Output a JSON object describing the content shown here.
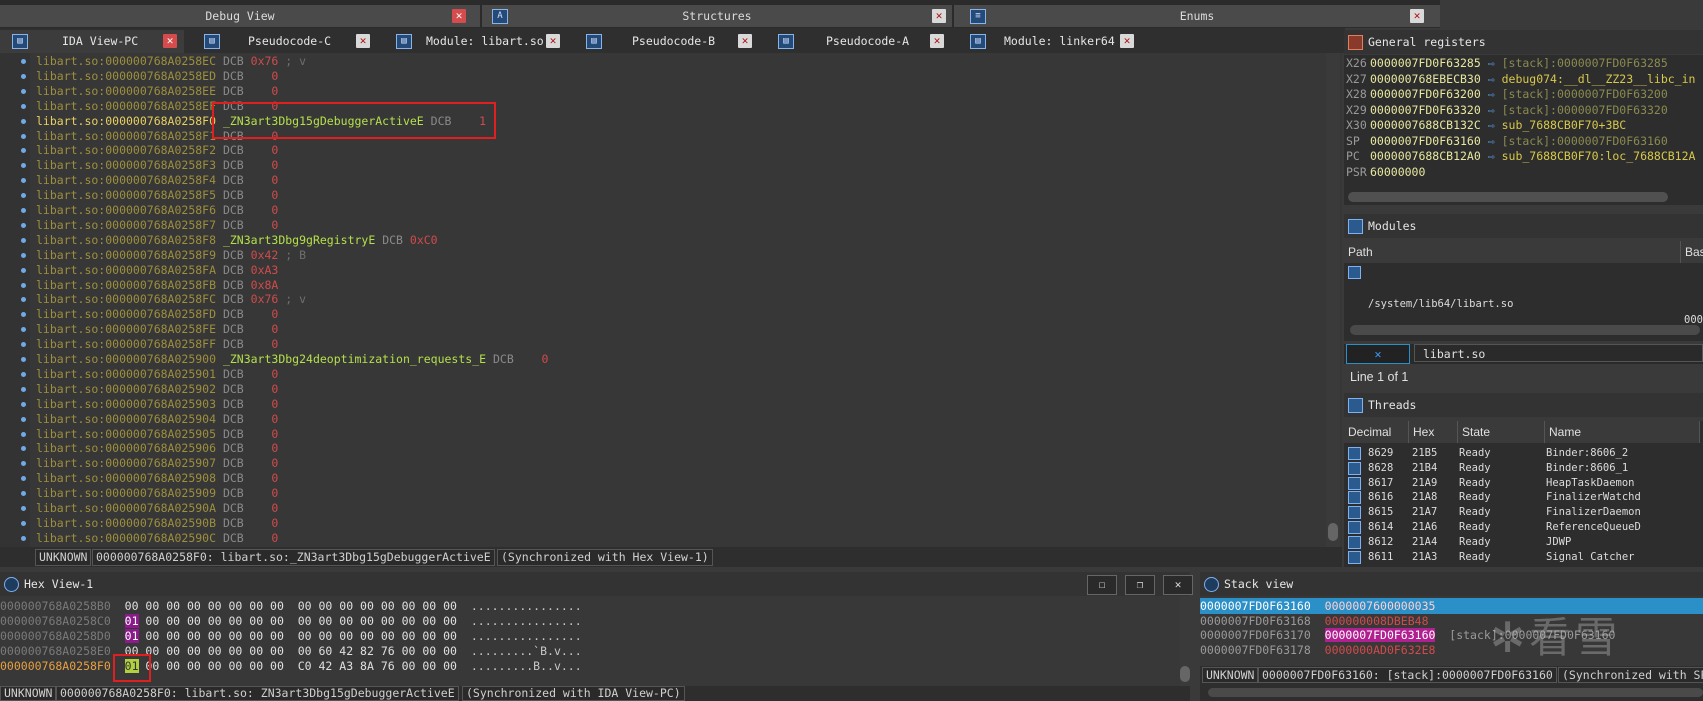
{
  "top_tabs": [
    {
      "label": "Debug View"
    },
    {
      "label": "Structures"
    },
    {
      "label": "Enums"
    }
  ],
  "sub_tabs": [
    {
      "label": "IDA View-PC"
    },
    {
      "label": "Pseudocode-C"
    },
    {
      "label": "Module: libart.so"
    },
    {
      "label": "Pseudocode-B"
    },
    {
      "label": "Pseudocode-A"
    },
    {
      "label": "Module: linker64"
    }
  ],
  "disasm": {
    "lines": [
      {
        "addr": "libart.so:000000768A0258EC",
        "tail": " DCB ",
        "val": "0x76",
        "cmt": " ; v"
      },
      {
        "addr": "libart.so:000000768A0258ED",
        "tail": " DCB ",
        "val": "   0",
        "cmt": ""
      },
      {
        "addr": "libart.so:000000768A0258EE",
        "tail": " DCB ",
        "val": "   0",
        "cmt": ""
      },
      {
        "addr": "libart.so:000000768A0258EF",
        "tail": " DCB ",
        "val": "   0",
        "cmt": ""
      },
      {
        "addr": "libart.so:000000768A0258F0",
        "sym": " _ZN3art3Dbg15gDebuggerActiveE",
        "tail": " DCB ",
        "val": "   1",
        "cur": true
      },
      {
        "addr": "libart.so:000000768A0258F1",
        "tail": " DCB ",
        "val": "   0",
        "cmt": ""
      },
      {
        "addr": "libart.so:000000768A0258F2",
        "tail": " DCB ",
        "val": "   0",
        "cmt": ""
      },
      {
        "addr": "libart.so:000000768A0258F3",
        "tail": " DCB ",
        "val": "   0",
        "cmt": ""
      },
      {
        "addr": "libart.so:000000768A0258F4",
        "tail": " DCB ",
        "val": "   0",
        "cmt": ""
      },
      {
        "addr": "libart.so:000000768A0258F5",
        "tail": " DCB ",
        "val": "   0",
        "cmt": ""
      },
      {
        "addr": "libart.so:000000768A0258F6",
        "tail": " DCB ",
        "val": "   0",
        "cmt": ""
      },
      {
        "addr": "libart.so:000000768A0258F7",
        "tail": " DCB ",
        "val": "   0",
        "cmt": ""
      },
      {
        "addr": "libart.so:000000768A0258F8",
        "sym": " _ZN3art3Dbg9gRegistryE",
        "tail": " DCB ",
        "val": "0xC0",
        "cmt": ""
      },
      {
        "addr": "libart.so:000000768A0258F9",
        "tail": " DCB ",
        "val": "0x42",
        "cmt": " ; B"
      },
      {
        "addr": "libart.so:000000768A0258FA",
        "tail": " DCB ",
        "val": "0xA3",
        "cmt": ""
      },
      {
        "addr": "libart.so:000000768A0258FB",
        "tail": " DCB ",
        "val": "0x8A",
        "cmt": ""
      },
      {
        "addr": "libart.so:000000768A0258FC",
        "tail": " DCB ",
        "val": "0x76",
        "cmt": " ; v"
      },
      {
        "addr": "libart.so:000000768A0258FD",
        "tail": " DCB ",
        "val": "   0",
        "cmt": ""
      },
      {
        "addr": "libart.so:000000768A0258FE",
        "tail": " DCB ",
        "val": "   0",
        "cmt": ""
      },
      {
        "addr": "libart.so:000000768A0258FF",
        "tail": " DCB ",
        "val": "   0",
        "cmt": ""
      },
      {
        "addr": "libart.so:000000768A025900",
        "sym": " _ZN3art3Dbg24deoptimization_requests_E",
        "tail": " DCB ",
        "val": "   0",
        "cmt": ""
      },
      {
        "addr": "libart.so:000000768A025901",
        "tail": " DCB ",
        "val": "   0",
        "cmt": ""
      },
      {
        "addr": "libart.so:000000768A025902",
        "tail": " DCB ",
        "val": "   0",
        "cmt": ""
      },
      {
        "addr": "libart.so:000000768A025903",
        "tail": " DCB ",
        "val": "   0",
        "cmt": ""
      },
      {
        "addr": "libart.so:000000768A025904",
        "tail": " DCB ",
        "val": "   0",
        "cmt": ""
      },
      {
        "addr": "libart.so:000000768A025905",
        "tail": " DCB ",
        "val": "   0",
        "cmt": ""
      },
      {
        "addr": "libart.so:000000768A025906",
        "tail": " DCB ",
        "val": "   0",
        "cmt": ""
      },
      {
        "addr": "libart.so:000000768A025907",
        "tail": " DCB ",
        "val": "   0",
        "cmt": ""
      },
      {
        "addr": "libart.so:000000768A025908",
        "tail": " DCB ",
        "val": "   0",
        "cmt": ""
      },
      {
        "addr": "libart.so:000000768A025909",
        "tail": " DCB ",
        "val": "   0",
        "cmt": ""
      },
      {
        "addr": "libart.so:000000768A02590A",
        "tail": " DCB ",
        "val": "   0",
        "cmt": ""
      },
      {
        "addr": "libart.so:000000768A02590B",
        "tail": " DCB ",
        "val": "   0",
        "cmt": ""
      },
      {
        "addr": "libart.so:000000768A02590C",
        "tail": " DCB ",
        "val": "   0",
        "cmt": ""
      }
    ]
  },
  "status1": {
    "mode": "UNKNOWN",
    "location": "000000768A0258F0: libart.so:_ZN3art3Dbg15gDebuggerActiveE",
    "sync": "(Synchronized with Hex View-1)"
  },
  "registers": {
    "title": "General registers",
    "rows": [
      {
        "name": "X26",
        "value": "0000007FD0F63285",
        "desc": "[stack]:0000007FD0F63285",
        "gray": true
      },
      {
        "name": "X27",
        "value": "000000768EBECB30",
        "desc": "debug074:__dl__ZZ23__libc_in",
        "gray": false
      },
      {
        "name": "X28",
        "value": "0000007FD0F63200",
        "desc": "[stack]:0000007FD0F63200",
        "gray": true
      },
      {
        "name": "X29",
        "value": "0000007FD0F63320",
        "desc": "[stack]:0000007FD0F63320",
        "gray": true
      },
      {
        "name": "X30",
        "value": "0000007688CB132C",
        "desc": "sub_7688CB0F70+3BC",
        "gray": false
      },
      {
        "name": "SP",
        "value": "0000007FD0F63160",
        "desc": "[stack]:0000007FD0F63160",
        "gray": true
      },
      {
        "name": "PC",
        "value": "0000007688CB12A0",
        "desc": "sub_7688CB0F70:loc_7688CB12A",
        "gray": false
      },
      {
        "name": "PSR",
        "value": "60000000",
        "desc": "",
        "gray": false
      }
    ]
  },
  "modules": {
    "title": "Modules",
    "col_path": "Path",
    "col_base": "Bas",
    "rows": [
      {
        "path": "/system/lib64/libart.so",
        "base": "000"
      }
    ],
    "filter_value": "libart.so",
    "line_info": "Line 1 of 1"
  },
  "threads": {
    "title": "Threads",
    "cols": [
      "Decimal",
      "Hex",
      "State",
      "Name"
    ],
    "rows": [
      {
        "dec": "8629",
        "hex": "21B5",
        "state": "Ready",
        "name": "Binder:8606_2"
      },
      {
        "dec": "8628",
        "hex": "21B4",
        "state": "Ready",
        "name": "Binder:8606_1"
      },
      {
        "dec": "8617",
        "hex": "21A9",
        "state": "Ready",
        "name": "HeapTaskDaemon"
      },
      {
        "dec": "8616",
        "hex": "21A8",
        "state": "Ready",
        "name": "FinalizerWatchd"
      },
      {
        "dec": "8615",
        "hex": "21A7",
        "state": "Ready",
        "name": "FinalizerDaemon"
      },
      {
        "dec": "8614",
        "hex": "21A6",
        "state": "Ready",
        "name": "ReferenceQueueD"
      },
      {
        "dec": "8612",
        "hex": "21A4",
        "state": "Ready",
        "name": "JDWP"
      },
      {
        "dec": "8611",
        "hex": "21A3",
        "state": "Ready",
        "name": "Signal Catcher"
      }
    ]
  },
  "hexview": {
    "title": "Hex View-1",
    "rows": [
      {
        "addr": "000000768A0258B0",
        "b1": "00",
        "rest": " 00 00 00 00 00 00 00  00 00 00 00 00 00 00 00",
        "ascii": "................",
        "hl": ""
      },
      {
        "addr": "000000768A0258C0",
        "b1": "01",
        "rest": " 00 00 00 00 00 00 00  00 00 00 00 00 00 00 00",
        "ascii": "................",
        "hl": "purple"
      },
      {
        "addr": "000000768A0258D0",
        "b1": "01",
        "rest": " 00 00 00 00 00 00 00  00 00 00 00 00 00 00 00",
        "ascii": "................",
        "hl": "purple"
      },
      {
        "addr": "000000768A0258E0",
        "b1": "00",
        "rest": " 00 00 00 00 00 00 00  00 60 42 82 76 00 00 00",
        "ascii": ".........`B.v...",
        "hl": ""
      },
      {
        "addr": "000000768A0258F0",
        "b1": "01",
        "rest": " 00 00 00 00 00 00 00  C0 42 A3 8A 76 00 00 00",
        "ascii": ".........B..v...",
        "hl": "green",
        "cur": true
      }
    ],
    "status_mode": "UNKNOWN",
    "status_loc": "000000768A0258F0: libart.so: ZN3art3Dbg15gDebuggerActiveE",
    "status_sync": "(Synchronized with IDA View-PC)"
  },
  "stackview": {
    "title": "Stack view",
    "rows": [
      {
        "addr": "0000007FD0F63160",
        "val": "0000007600000035",
        "extra": ""
      },
      {
        "addr": "0000007FD0F63168",
        "val": "000000008DBEB48",
        "extra": ""
      },
      {
        "addr": "0000007FD0F63170",
        "val": "0000007FD0F63160",
        "extra": "[stack]:0000007FD0F63160"
      },
      {
        "addr": "0000007FD0F63178",
        "val": "0000000AD0F632E8",
        "extra": ""
      }
    ],
    "status_mode": "UNKNOWN",
    "status_loc": "0000007FD0F63160: [stack]:0000007FD0F63160",
    "status_sync": "(Synchronized with SP)"
  },
  "colors": {
    "accent": "#2b8fc8",
    "highlight_red": "#e02020",
    "symbol": "#b4e04a",
    "number": "#d04b4b"
  }
}
